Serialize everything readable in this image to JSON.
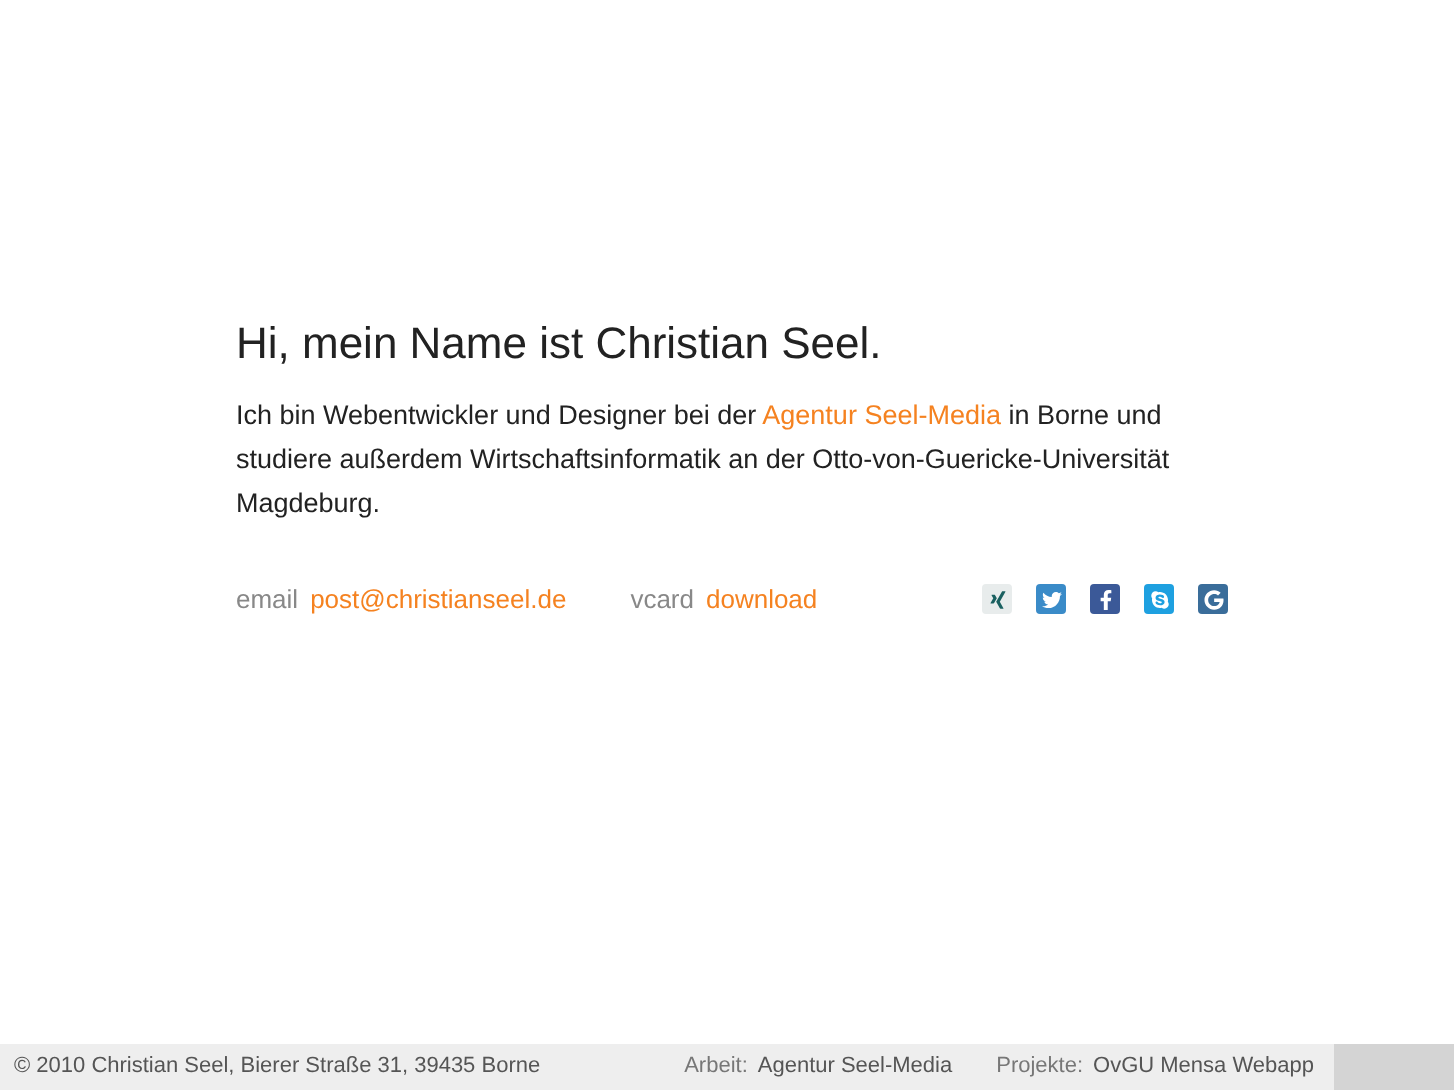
{
  "heading": "Hi, mein Name ist Christian Seel.",
  "intro": "Ich bin Webentwickler und Designer bei der ",
  "intro_link": "Agentur Seel-Media",
  "intro_rest": " in Borne und studiere außerdem Wirtschaftsinformatik an der Otto-von-Guericke-Universität Magdeburg.",
  "contacts": [
    {
      "label": "email",
      "value": "post@christianseel.de"
    },
    {
      "label": "vcard",
      "value": "download"
    }
  ],
  "social_icons": [
    {
      "kind": "xing"
    },
    {
      "kind": "twitter"
    },
    {
      "kind": "facebook"
    },
    {
      "kind": "skype"
    },
    {
      "kind": "google"
    }
  ],
  "footer": {
    "copyright": "© 2010 Christian Seel, Bierer Straße 31, 39435 Borne",
    "links": [
      {
        "label": "Arbeit:",
        "value": "Agentur Seel-Media"
      },
      {
        "label": "Projekte:",
        "value": "OvGU Mensa Webapp"
      }
    ]
  }
}
